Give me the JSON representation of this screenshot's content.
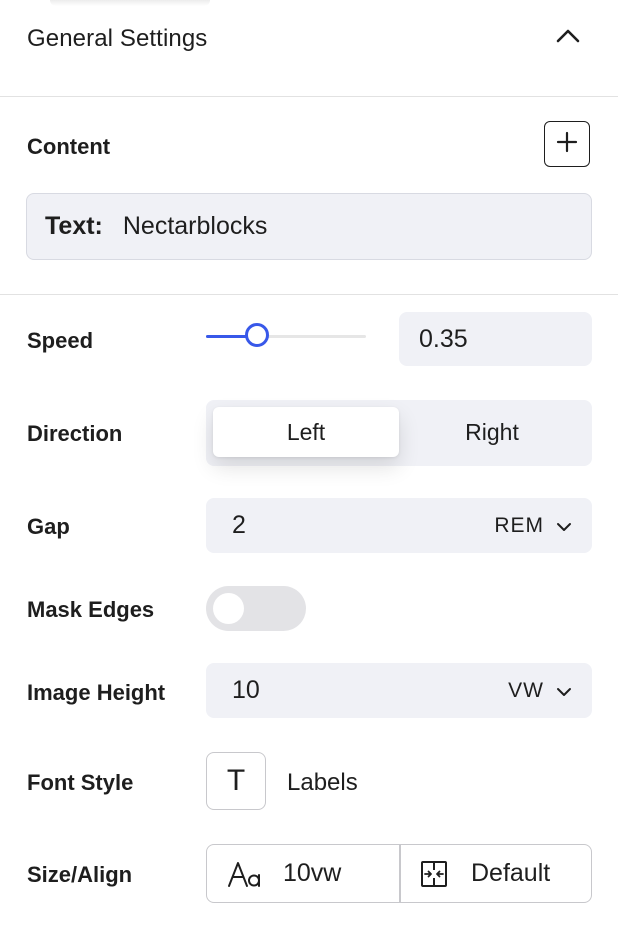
{
  "section": {
    "title": "General Settings",
    "collapse_icon": "chevron-up-icon"
  },
  "content": {
    "label": "Content",
    "add_icon": "plus-icon",
    "item_key": "Text:",
    "item_value": "Nectarblocks"
  },
  "speed": {
    "label": "Speed",
    "value": "0.35",
    "slider_fraction": 0.32,
    "accent": "#3858e9"
  },
  "direction": {
    "label": "Direction",
    "options": [
      "Left",
      "Right"
    ],
    "selected": "Left"
  },
  "gap": {
    "label": "Gap",
    "value": "2",
    "unit": "REM"
  },
  "mask_edges": {
    "label": "Mask Edges",
    "enabled": false
  },
  "image_height": {
    "label": "Image Height",
    "value": "10",
    "unit": "VW"
  },
  "font_style": {
    "label": "Font Style",
    "button_glyph": "T",
    "value": "Labels"
  },
  "size_align": {
    "label": "Size/Align",
    "size_icon": "font-size-icon",
    "size_value": "10vw",
    "align_icon": "alignment-icon",
    "align_value": "Default"
  }
}
